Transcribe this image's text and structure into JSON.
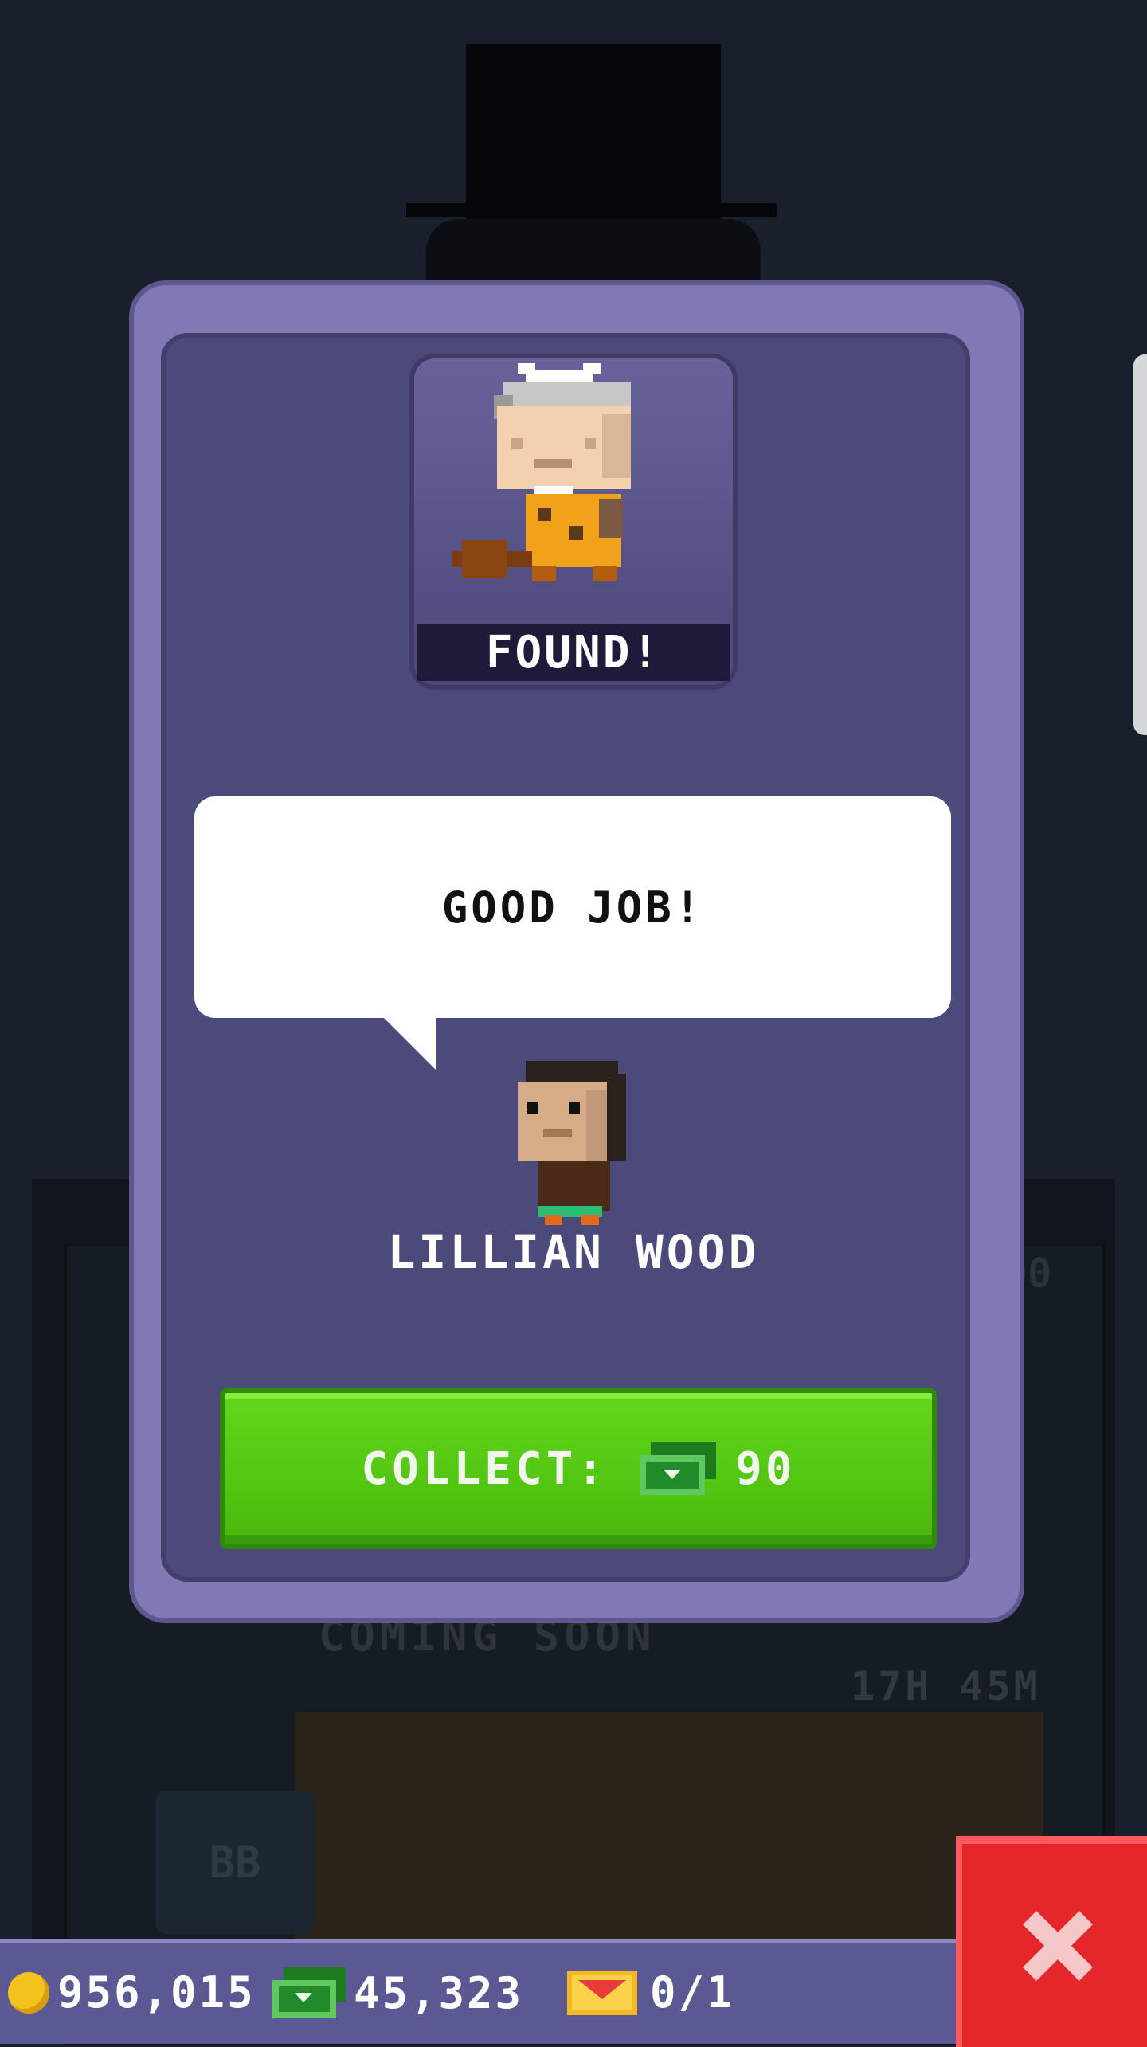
{
  "background": {
    "coming_soon": "COMING SOON",
    "timer": "17H 45M",
    "partial_counter": "00",
    "room_label": "BB"
  },
  "modal": {
    "status": "FOUND!",
    "speech": "GOOD JOB!",
    "npc_name": "LILLIAN WOOD",
    "collect": {
      "label": "COLLECT:",
      "amount": "90",
      "currency_icon": "bux-icon"
    }
  },
  "status_bar": {
    "coins": {
      "icon": "coin-icon",
      "value": "956,015"
    },
    "bux": {
      "icon": "bux-icon",
      "value": "45,323"
    },
    "tickets": {
      "icon": "ticket-icon",
      "value": "0/1"
    }
  },
  "close_button": {
    "icon": "close-icon"
  },
  "colors": {
    "modal_outer": "#7f79b6",
    "modal_inner": "#4c4a7b",
    "collect_green": "#55c812",
    "close_red": "#e5262b",
    "status_bar": "#5b5993"
  }
}
